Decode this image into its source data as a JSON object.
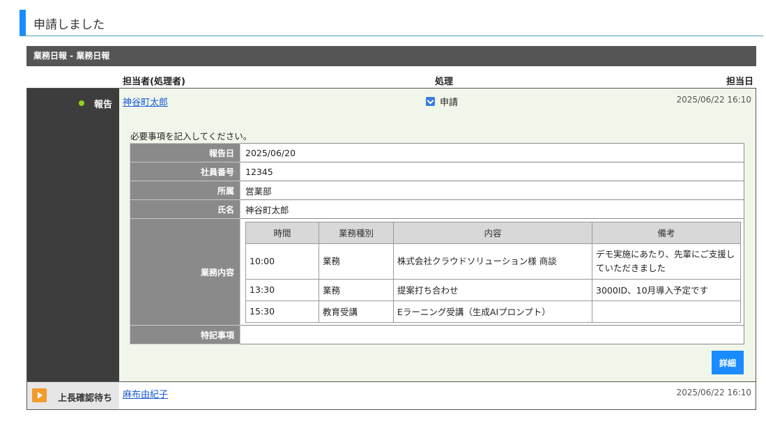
{
  "page": {
    "title": "申請しました"
  },
  "section": {
    "title": "業務日報 - 業務日報"
  },
  "columns": {
    "assignee": "担当者(処理者)",
    "action": "処理",
    "date": "担当日"
  },
  "report_step": {
    "label": "報告",
    "assignee": "神谷町太郎",
    "action": "申請",
    "date": "2025/06/22 16:10",
    "instruction": "必要事項を記入してください。",
    "fields": {
      "report_date": {
        "label": "報告日",
        "value": "2025/06/20"
      },
      "employee_no": {
        "label": "社員番号",
        "value": "12345"
      },
      "department": {
        "label": "所属",
        "value": "営業部"
      },
      "name": {
        "label": "氏名",
        "value": "神谷町太郎"
      },
      "work_content": {
        "label": "業務内容"
      },
      "notes": {
        "label": "特記事項",
        "value": ""
      }
    },
    "work_table": {
      "headers": [
        "時間",
        "業務種別",
        "内容",
        "備考"
      ],
      "rows": [
        [
          "10:00",
          "業務",
          "株式会社クラウドソリューション様 商談",
          "デモ実施にあたり、先輩にご支援していただきました"
        ],
        [
          "13:30",
          "業務",
          "提案打ち合わせ",
          "3000ID、10月導入予定です"
        ],
        [
          "15:30",
          "教育受講",
          "Eラーニング受講（生成AIプロンプト）",
          ""
        ]
      ]
    },
    "detail_button": "詳細"
  },
  "wait_step": {
    "label": "上長確認待ち",
    "assignee": "麻布由紀子",
    "date": "2025/06/22 16:10"
  },
  "colors": {
    "accent": "#1a8cff",
    "status_done": "#8fd11e",
    "status_wait": "#f29b2b",
    "header_bar": "#555555"
  }
}
